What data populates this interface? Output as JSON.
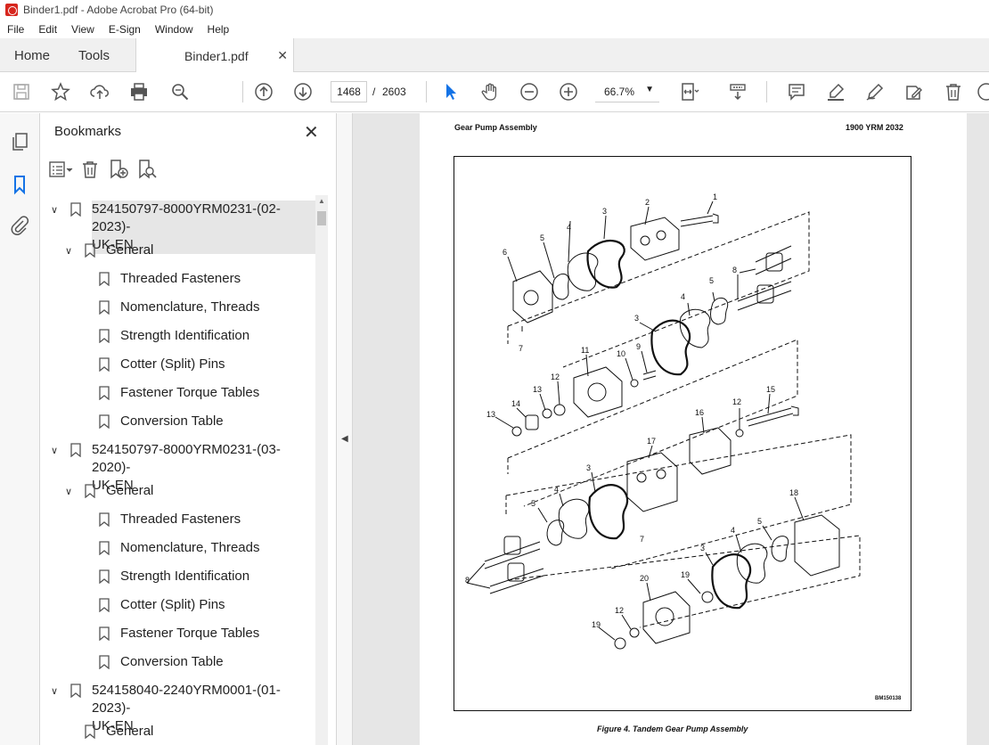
{
  "window": {
    "title": "Binder1.pdf - Adobe Acrobat Pro (64-bit)"
  },
  "menu": [
    "File",
    "Edit",
    "View",
    "E-Sign",
    "Window",
    "Help"
  ],
  "tabs": {
    "home": "Home",
    "tools": "Tools",
    "document": "Binder1.pdf"
  },
  "toolbar": {
    "page_current": "1468",
    "page_separator": "/",
    "page_total": "2603",
    "zoom": "66.7%"
  },
  "bookmarks": {
    "title": "Bookmarks",
    "items": [
      {
        "label": "524150797-8000YRM0231-(02-2023)-",
        "label2": "UK-EN",
        "level": 0
      },
      {
        "label": "General",
        "level": 1
      },
      {
        "label": "Threaded Fasteners",
        "level": 2
      },
      {
        "label": "Nomenclature, Threads",
        "level": 2
      },
      {
        "label": "Strength Identification",
        "level": 2
      },
      {
        "label": "Cotter (Split) Pins",
        "level": 2
      },
      {
        "label": "Fastener Torque Tables",
        "level": 2
      },
      {
        "label": "Conversion Table",
        "level": 2
      },
      {
        "label": "524150797-8000YRM0231-(03-2020)-",
        "label2": "UK-EN",
        "level": 0
      },
      {
        "label": "General",
        "level": 1
      },
      {
        "label": "Threaded Fasteners",
        "level": 2
      },
      {
        "label": "Nomenclature, Threads",
        "level": 2
      },
      {
        "label": "Strength Identification",
        "level": 2
      },
      {
        "label": "Cotter (Split) Pins",
        "level": 2
      },
      {
        "label": "Fastener Torque Tables",
        "level": 2
      },
      {
        "label": "Conversion Table",
        "level": 2
      },
      {
        "label": "524158040-2240YRM0001-(01-2023)-",
        "label2": "UK-EN",
        "level": 0
      },
      {
        "label": "General",
        "level": 1
      }
    ]
  },
  "document": {
    "header_left": "Gear Pump Assembly",
    "header_right": "1900 YRM 2032",
    "figure_code": "BM150138",
    "caption": "Figure 4. Tandem Gear Pump Assembly",
    "callouts": [
      "1",
      "2",
      "3",
      "4",
      "5",
      "6",
      "7",
      "8",
      "3",
      "4",
      "5",
      "7",
      "11",
      "10",
      "9",
      "12",
      "13",
      "14",
      "13",
      "15",
      "16",
      "12",
      "17",
      "3",
      "4",
      "5",
      "7",
      "18",
      "8",
      "5",
      "4",
      "3",
      "20",
      "19",
      "12",
      "19"
    ]
  },
  "colors": {
    "accent": "#1473e6",
    "acrobat_red": "#d7261e"
  }
}
